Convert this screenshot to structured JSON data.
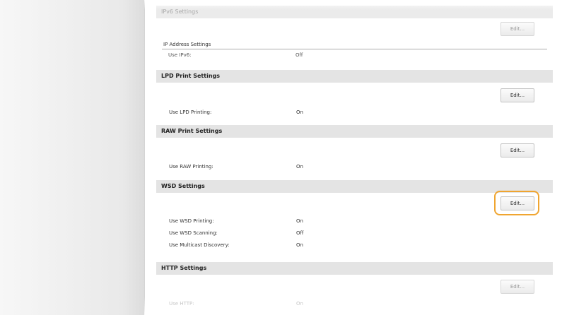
{
  "sections": {
    "ipv6": {
      "title": "IPv6 Settings",
      "edit_label": "Edit...",
      "subheading": "IP Address Settings",
      "rows": [
        {
          "label": "Use IPv6:",
          "value": "Off"
        }
      ]
    },
    "lpd": {
      "title": "LPD Print Settings",
      "edit_label": "Edit...",
      "rows": [
        {
          "label": "Use LPD Printing:",
          "value": "On"
        }
      ]
    },
    "raw": {
      "title": "RAW Print Settings",
      "edit_label": "Edit...",
      "rows": [
        {
          "label": "Use RAW Printing:",
          "value": "On"
        }
      ]
    },
    "wsd": {
      "title": "WSD Settings",
      "edit_label": "Edit...",
      "rows": [
        {
          "label": "Use WSD Printing:",
          "value": "On"
        },
        {
          "label": "Use WSD Scanning:",
          "value": "Off"
        },
        {
          "label": "Use Multicast Discovery:",
          "value": "On"
        }
      ]
    },
    "http": {
      "title": "HTTP Settings",
      "edit_label": "Edit...",
      "rows": [
        {
          "label": "Use HTTP:",
          "value": "On"
        }
      ]
    }
  },
  "colors": {
    "highlight": "#f0a530",
    "section_header_bg": "#e4e4e4"
  }
}
